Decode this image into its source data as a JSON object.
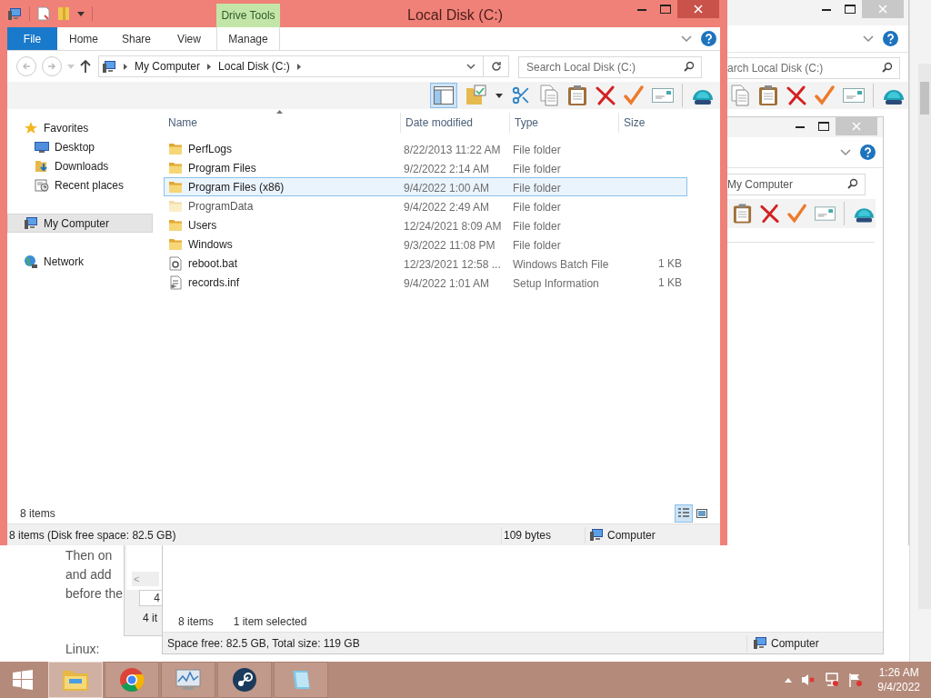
{
  "background_page": {
    "lines": [
      "Then on",
      "and add",
      "before the",
      "Linux:"
    ]
  },
  "back_window": {
    "search": {
      "placeholder": "arch Local Disk (C:)"
    }
  },
  "middle_window": {
    "search": {
      "value": "My Computer"
    },
    "item_count": "8 items",
    "selection": "1 item selected",
    "status": "Space free: 82.5 GB, Total size: 119 GB",
    "location": "Computer"
  },
  "small_window": {
    "scroll_button": "<",
    "cell": "4",
    "status": "4 it"
  },
  "window": {
    "title": "Local Disk (C:)",
    "context_tab": "Drive Tools",
    "ribbon_tabs": [
      {
        "label": "File",
        "kind": "menu"
      },
      {
        "label": "Home",
        "kind": "tab"
      },
      {
        "label": "Share",
        "kind": "tab"
      },
      {
        "label": "View",
        "kind": "tab"
      },
      {
        "label": "Manage",
        "kind": "context"
      }
    ],
    "breadcrumb": [
      "My Computer",
      "Local Disk (C:)"
    ],
    "search": {
      "placeholder": "Search Local Disk (C:)"
    },
    "preview_pane": {
      "selected": true
    },
    "sidebar": {
      "items": [
        {
          "label": "Favorites",
          "selected": false,
          "children": [
            {
              "label": "Desktop",
              "selected": false
            },
            {
              "label": "Downloads",
              "selected": false
            },
            {
              "label": "Recent places",
              "selected": false
            }
          ]
        },
        {
          "label": "My Computer",
          "selected": true
        },
        {
          "label": "Network",
          "selected": false
        }
      ]
    },
    "columns": [
      {
        "label": "Name",
        "sorted": true
      },
      {
        "label": "Date modified",
        "sorted": false
      },
      {
        "label": "Type",
        "sorted": false
      },
      {
        "label": "Size",
        "sorted": false
      }
    ],
    "rows": [
      {
        "name": "PerfLogs",
        "date": "8/22/2013 11:22 AM",
        "type": "File folder",
        "kind": "folder",
        "hidden": false,
        "selected": false
      },
      {
        "name": "Program Files",
        "date": "9/2/2022 2:14 AM",
        "type": "File folder",
        "kind": "folder",
        "hidden": false,
        "selected": false
      },
      {
        "name": "Program Files (x86)",
        "date": "9/4/2022 1:00 AM",
        "type": "File folder",
        "kind": "folder",
        "hidden": false,
        "selected": true
      },
      {
        "name": "ProgramData",
        "date": "9/4/2022 2:49 AM",
        "type": "File folder",
        "kind": "folder",
        "hidden": true,
        "selected": false
      },
      {
        "name": "Users",
        "date": "12/24/2021 8:09 AM",
        "type": "File folder",
        "kind": "folder",
        "hidden": false,
        "selected": false
      },
      {
        "name": "Windows",
        "date": "9/3/2022 11:08 PM",
        "type": "File folder",
        "kind": "folder",
        "hidden": false,
        "selected": false
      },
      {
        "name": "reboot.bat",
        "date": "12/23/2021 12:58 ...",
        "type": "Windows Batch File",
        "size": "1 KB",
        "kind": "batch",
        "hidden": false,
        "selected": false
      },
      {
        "name": "records.inf",
        "date": "9/4/2022 1:01 AM",
        "type": "Setup Information",
        "size": "1 KB",
        "kind": "setup",
        "hidden": false,
        "selected": false
      }
    ],
    "item_count": "8 items",
    "view_buttons": [
      {
        "selected": true
      },
      {
        "selected": false
      }
    ],
    "status_bar": {
      "summary": "8 items (Disk free space: 82.5 GB)",
      "size": "109 bytes",
      "location": "Computer"
    }
  },
  "taskbar": {
    "apps": [
      {
        "selected": true
      },
      {
        "selected": false
      },
      {
        "selected": false
      },
      {
        "selected": false
      },
      {
        "selected": false
      }
    ],
    "time": "1:26 AM",
    "date": "9/4/2022"
  }
}
